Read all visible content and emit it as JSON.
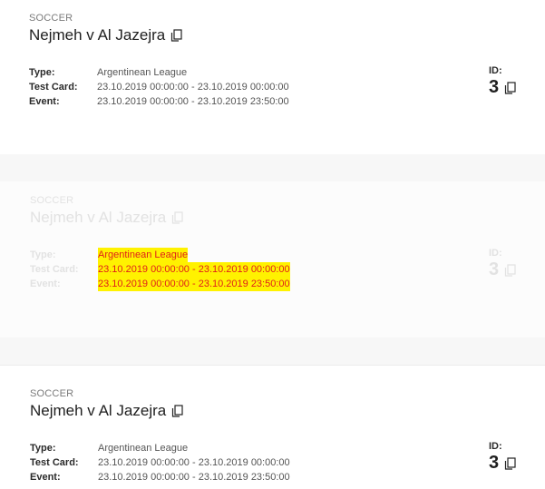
{
  "cards": [
    {
      "sport": "SOCCER",
      "title": "Nejmeh v Al Jazejra",
      "type_label": "Type:",
      "type_value": "Argentinean League",
      "test_label": "Test Card:",
      "test_value": "23.10.2019 00:00:00 - 23.10.2019 00:00:00",
      "event_label": "Event:",
      "event_value": "23.10.2019 00:00:00 - 23.10.2019 23:50:00",
      "id_label": "ID:",
      "id_value": "3"
    },
    {
      "sport": "SOCCER",
      "title": "Nejmeh v Al Jazejra",
      "type_label": "Type:",
      "type_value": "Argentinean League",
      "test_label": "Test Card:",
      "test_value": "23.10.2019 00:00:00 - 23.10.2019 00:00:00",
      "event_label": "Event:",
      "event_value": "23.10.2019 00:00:00 - 23.10.2019 23:50:00",
      "id_label": "ID:",
      "id_value": "3"
    },
    {
      "sport": "SOCCER",
      "title": "Nejmeh v Al Jazejra",
      "type_label": "Type:",
      "type_value": "Argentinean League",
      "test_label": "Test Card:",
      "test_value": "23.10.2019 00:00:00 - 23.10.2019 00:00:00",
      "event_label": "Event:",
      "event_value": "23.10.2019 00:00:00 - 23.10.2019 23:50:00",
      "id_label": "ID:",
      "id_value": "3"
    }
  ],
  "colors": {
    "highlight_bg": "#fff200",
    "highlight_text": "#e0201a",
    "faded_text": "#e2e2e2"
  },
  "icons": [
    "copy-icon"
  ]
}
